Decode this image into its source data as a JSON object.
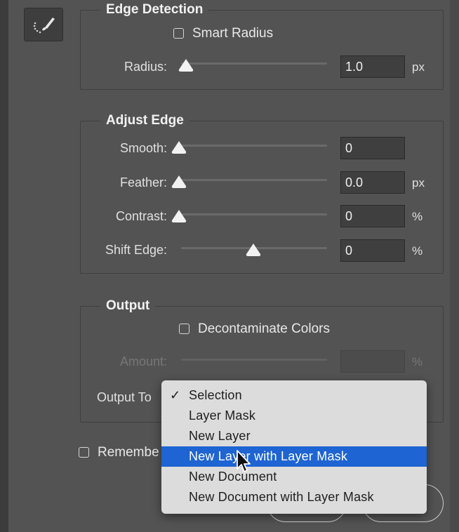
{
  "edge_detection": {
    "title": "Edge Detection",
    "smart_radius_label": "Smart Radius",
    "smart_radius_checked": false,
    "radius_label": "Radius:",
    "radius_value": "1.0",
    "radius_unit": "px"
  },
  "adjust_edge": {
    "title": "Adjust Edge",
    "smooth_label": "Smooth:",
    "smooth_value": "0",
    "feather_label": "Feather:",
    "feather_value": "0.0",
    "feather_unit": "px",
    "contrast_label": "Contrast:",
    "contrast_value": "0",
    "contrast_unit": "%",
    "shift_edge_label": "Shift Edge:",
    "shift_edge_value": "0",
    "shift_edge_unit": "%"
  },
  "output": {
    "title": "Output",
    "decontaminate_label": "Decontaminate Colors",
    "decontaminate_checked": false,
    "amount_label": "Amount:",
    "amount_value": "",
    "amount_unit": "%",
    "output_to_label": "Output To",
    "remember_label": "Remembe"
  },
  "output_menu": {
    "items": [
      "Selection",
      "Layer Mask",
      "New Layer",
      "New Layer with Layer Mask",
      "New Document",
      "New Document with Layer Mask"
    ],
    "checked_index": 0,
    "highlighted_index": 3,
    "checkmark": "✓"
  },
  "colors": {
    "highlight": "#1e64d2",
    "panel_bg": "#535353"
  }
}
